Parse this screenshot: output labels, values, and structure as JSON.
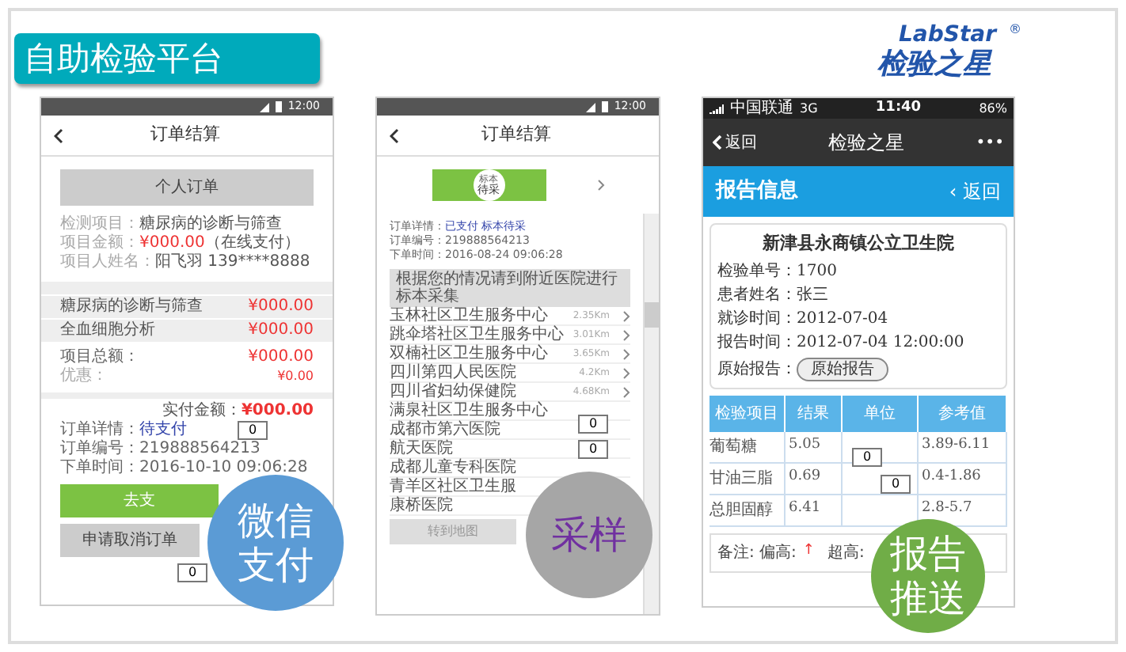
{
  "slide": {
    "title": "自助检验平台",
    "logo": {
      "latin": "LabStar",
      "cjk": "检验之星",
      "mark": "®"
    }
  },
  "payment_screen": {
    "time": "12:00",
    "title": "订单结算",
    "order_button": "个人订单",
    "info": [
      {
        "label": "检测项目：",
        "value": "糖尿病的诊断与筛查",
        "kind": "plain"
      },
      {
        "label": "项目金额：",
        "value": "¥000.00",
        "extra": "（在线支付）",
        "kind": "price"
      },
      {
        "label": "项目人姓名：",
        "value": "阳飞羽   139****8888",
        "kind": "plain"
      }
    ],
    "items": [
      {
        "name": "糖尿病的诊断与筛查",
        "price": "¥000.00"
      },
      {
        "name": "全血细胞分析",
        "price": "¥000.00"
      }
    ],
    "total_label": "项目总额：",
    "total": "¥000.00",
    "discount_label": "优惠：",
    "discount": "¥0.00",
    "paid_label": "实付金额：",
    "paid": "¥000.00",
    "details": [
      {
        "label": "订单详情：",
        "value": "待支付",
        "kind": "status"
      },
      {
        "label": "订单编号：",
        "value": "219888564213",
        "kind": "plain"
      },
      {
        "label": "下单时间：",
        "value": "2016-10-10 09:06:28",
        "kind": "plain"
      }
    ],
    "pay_button": "去支",
    "cancel_button": "申请取消订单"
  },
  "sampling_screen": {
    "time": "12:00",
    "title": "订单结算",
    "step": [
      "标本",
      "待采"
    ],
    "details": [
      {
        "label": "订单详情：",
        "value": "已支付 标本待采",
        "kind": "status"
      },
      {
        "label": "订单编号：",
        "value": "219888564213",
        "kind": "plain"
      },
      {
        "label": "下单时间：",
        "value": "2016-08-24  09:06:28",
        "kind": "plain"
      }
    ],
    "prompt": "根据您的情况请到附近医院进行标本采集",
    "hospitals": [
      {
        "name": "玉林社区卫生服务中心",
        "distance": "2.35Km"
      },
      {
        "name": "跳伞塔社区卫生服务中心",
        "distance": "3.01Km"
      },
      {
        "name": "双楠社区卫生服务中心",
        "distance": "3.65Km"
      },
      {
        "name": "四川第四人民医院",
        "distance": "4.2Km"
      },
      {
        "name": "四川省妇幼保健院",
        "distance": "4.68Km"
      },
      {
        "name": "满泉社区卫生服务中心"
      },
      {
        "name": "成都市第六医院"
      },
      {
        "name": "航天医院"
      },
      {
        "name": "成都儿童专科医院"
      },
      {
        "name": "青羊区社区卫生服"
      },
      {
        "name": "康桥医院"
      }
    ],
    "map_button": "转到地图"
  },
  "report_screen": {
    "carrier": "中国联通",
    "network": "3G",
    "time": "11:40",
    "battery": "86%",
    "back": "返回",
    "title": "检验之星",
    "more": "•••",
    "section": "报告信息",
    "section_back": "‹ 返回",
    "hospital": "新津县永商镇公立卫生院",
    "fields": [
      {
        "label": "检验单号：",
        "value": "1700"
      },
      {
        "label": "患者姓名：",
        "value": "张三"
      },
      {
        "label": "就诊时间：",
        "value": "2012-07-04"
      },
      {
        "label": "报告时间：",
        "value": "2012-07-04 12:00:00"
      }
    ],
    "original_label": "原始报告：",
    "original_button": "原始报告",
    "columns": [
      "检验项目",
      "结果",
      "单位",
      "参考值"
    ],
    "rows": [
      [
        "葡萄糖",
        "5.05",
        "",
        "3.89-6.11"
      ],
      [
        "甘油三脂",
        "0.69",
        "",
        "0.4-1.86"
      ],
      [
        "总胆固醇",
        "6.41",
        "",
        "2.8-5.7"
      ]
    ],
    "note": "备注: 偏高:",
    "note_mark": "↑",
    "note_high": "超高:"
  },
  "badges": [
    {
      "lines": [
        "微信",
        "支付"
      ],
      "color": "#5b9bd5"
    },
    {
      "lines": [
        "采样"
      ],
      "color": "#a6a6a6"
    },
    {
      "lines": [
        "报告",
        "推送"
      ],
      "color": "#70ad47"
    }
  ],
  "markers": [
    "0",
    "0",
    "0",
    "0",
    "0",
    "0"
  ]
}
